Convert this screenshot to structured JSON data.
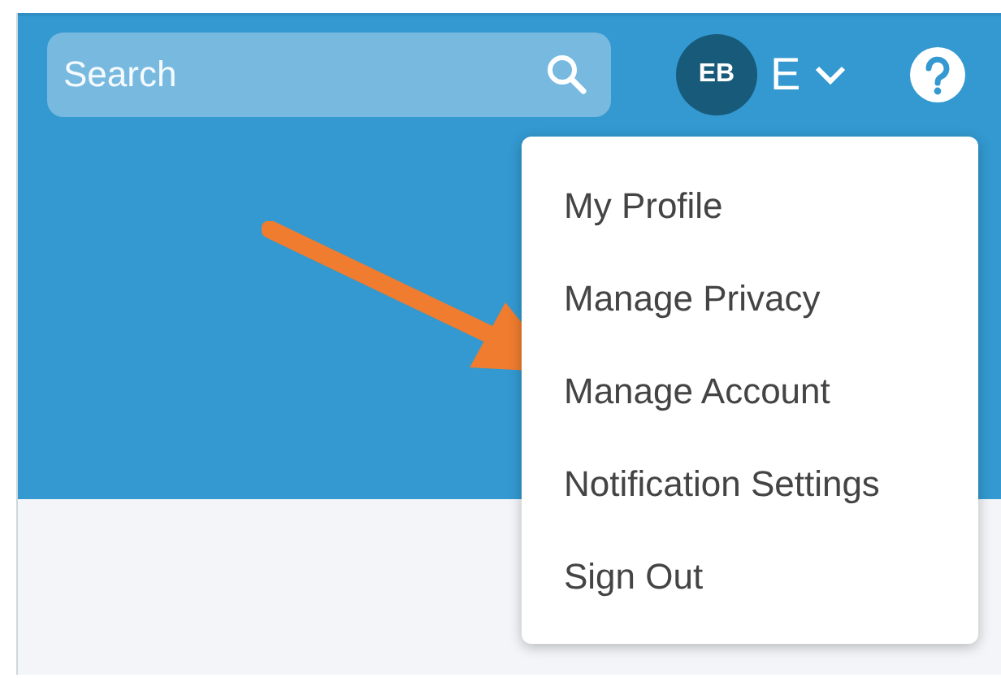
{
  "search": {
    "placeholder": "Search"
  },
  "user": {
    "initials": "EB",
    "name": "E"
  },
  "menu": {
    "items": [
      {
        "label": "My Profile"
      },
      {
        "label": "Manage Privacy"
      },
      {
        "label": "Manage Account"
      },
      {
        "label": "Notification Settings"
      },
      {
        "label": "Sign Out"
      }
    ]
  }
}
